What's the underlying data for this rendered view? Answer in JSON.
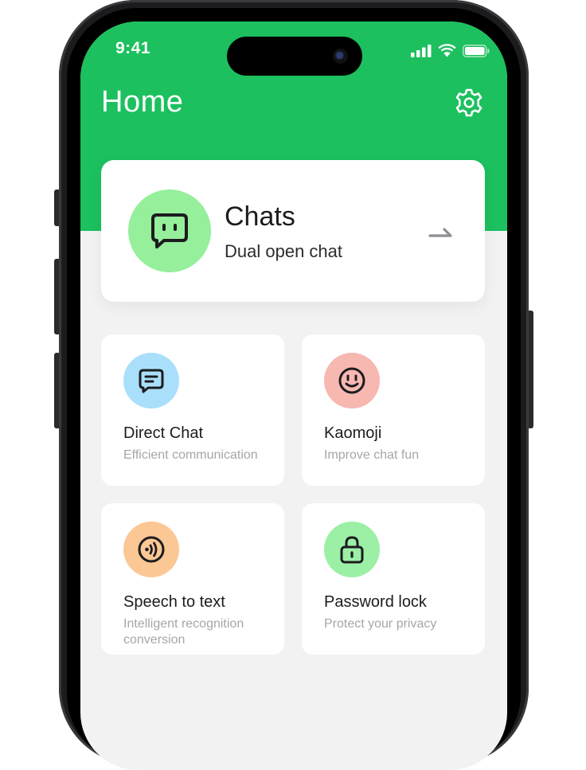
{
  "status_bar": {
    "time": "9:41"
  },
  "header": {
    "title": "Home"
  },
  "chats_card": {
    "title": "Chats",
    "subtitle": "Dual open chat"
  },
  "features": [
    {
      "title": "Direct Chat",
      "subtitle": "Efficient communication",
      "icon": "message-icon",
      "icon_bg": "#a9dffb"
    },
    {
      "title": "Kaomoji",
      "subtitle": "Improve chat fun",
      "icon": "smiley-icon",
      "icon_bg": "#f7b8b2"
    },
    {
      "title": "Speech to text",
      "subtitle": "Intelligent recognition conversion",
      "icon": "sound-wave-icon",
      "icon_bg": "#fbc795"
    },
    {
      "title": "Password lock",
      "subtitle": "Protect your privacy",
      "icon": "lock-icon",
      "icon_bg": "#9bf0a6"
    }
  ],
  "colors": {
    "brand_green": "#1cc05e",
    "chats_icon_bg": "#95ef9b",
    "background": "#f2f2f3"
  }
}
